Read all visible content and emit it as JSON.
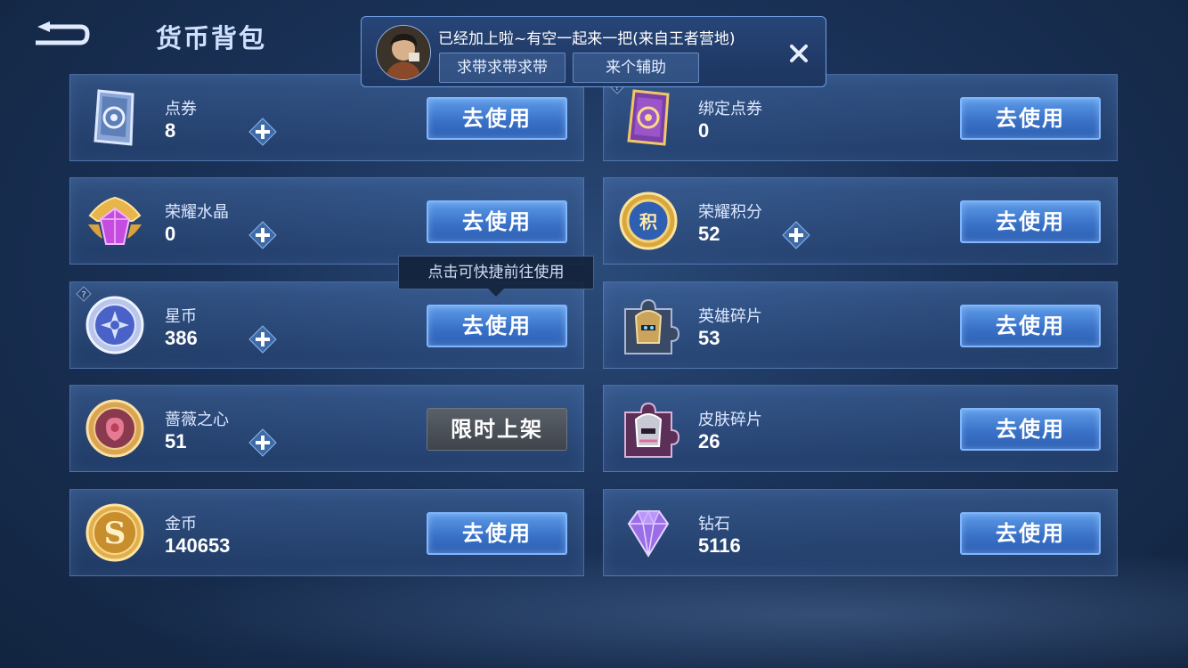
{
  "header": {
    "title": "货币背包",
    "back_icon": "back-arrow-icon"
  },
  "notification": {
    "message": "已经加上啦~有空一起来一把(来自王者营地)",
    "quick_replies": [
      "求带求带求带",
      "来个辅助"
    ],
    "close_icon": "close-icon"
  },
  "tooltip": {
    "text": "点击可快捷前往使用"
  },
  "currencies": [
    {
      "name": "点券",
      "amount": "8",
      "icon": "coupon-card-icon",
      "has_plus": true,
      "button": "去使用"
    },
    {
      "name": "绑定点券",
      "amount": "0",
      "icon": "bound-coupon-card-icon",
      "has_plus": false,
      "button": "去使用"
    },
    {
      "name": "荣耀水晶",
      "amount": "0",
      "icon": "glory-crystal-icon",
      "has_plus": true,
      "button": "去使用"
    },
    {
      "name": "荣耀积分",
      "amount": "52",
      "icon": "glory-points-icon",
      "has_plus": true,
      "button": "去使用"
    },
    {
      "name": "星币",
      "amount": "386",
      "icon": "star-coin-icon",
      "has_plus": true,
      "button": "去使用"
    },
    {
      "name": "英雄碎片",
      "amount": "53",
      "icon": "hero-fragment-icon",
      "has_plus": false,
      "button": "去使用"
    },
    {
      "name": "蔷薇之心",
      "amount": "51",
      "icon": "rose-heart-icon",
      "has_plus": true,
      "button": "限时上架"
    },
    {
      "name": "皮肤碎片",
      "amount": "26",
      "icon": "skin-fragment-icon",
      "has_plus": false,
      "button": "去使用"
    },
    {
      "name": "金币",
      "amount": "140653",
      "icon": "gold-coin-icon",
      "has_plus": false,
      "button": "去使用"
    },
    {
      "name": "钻石",
      "amount": "5116",
      "icon": "diamond-icon",
      "has_plus": false,
      "button": "去使用"
    }
  ],
  "colors": {
    "accent": "#3a72c8",
    "button_border": "#7fb6ff",
    "background": "#1a3258"
  }
}
